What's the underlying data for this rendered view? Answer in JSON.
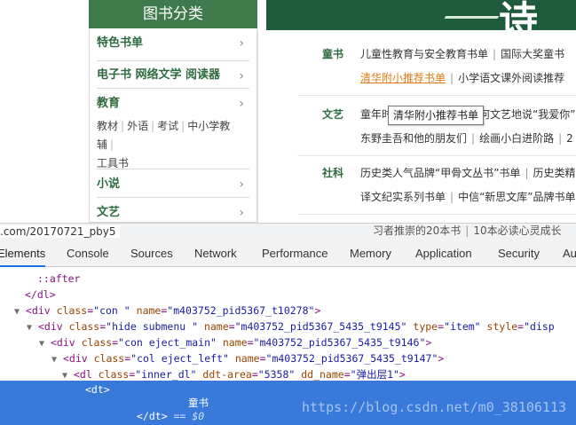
{
  "page": {
    "category_header": "图书分类",
    "banner_char": "诗",
    "side_menu": [
      {
        "title": "特色书单",
        "subs": []
      },
      {
        "title": "电子书 网络文学 阅读器",
        "subs": []
      },
      {
        "title": "教育",
        "subs": [
          "教材",
          "外语",
          "考试",
          "中小学教辅",
          "工具书"
        ]
      },
      {
        "title": "小说",
        "subs": []
      },
      {
        "title": "文艺",
        "subs": []
      }
    ],
    "arrow": "›",
    "sub_panel": {
      "rows": [
        {
          "label": "童书",
          "line1": [
            "儿童性教育与安全教育书单",
            "国际大奖童书"
          ],
          "line2": [
            "清华附小推荐书单",
            "小学语文课外阅读推荐"
          ]
        },
        {
          "label": "文艺",
          "line1": [
            "童年时",
            "何文艺地说“我爱你”"
          ],
          "line2": [
            "东野圭吾和他的朋友们",
            "绘画小白进阶路",
            "2"
          ]
        },
        {
          "label": "社科",
          "line1": [
            "历史类人气品牌“甲骨文丛书”书单",
            "历史类精"
          ],
          "line2": [
            "译文纪实系列书单",
            "中信“新思文库”品牌书单"
          ]
        }
      ],
      "last_line_fragment": "习者推崇的20本书",
      "last_line_fragment2": "10本必读心灵成长"
    },
    "tooltip": "清华附小推荐书单",
    "status_url": ".com/20170721_pby5"
  },
  "devtools": {
    "tabs": [
      "Elements",
      "Console",
      "Sources",
      "Network",
      "Performance",
      "Memory",
      "Application",
      "Security",
      "Au"
    ],
    "active_tab": "Elements",
    "lines": [
      {
        "indent": "    ",
        "content": "::after"
      },
      {
        "indent": "  ",
        "content": "</dl>"
      },
      {
        "indent": "",
        "content": "<div class=\"con \" name=\"m403752_pid5367_t10278\">"
      },
      {
        "indent": "  ",
        "content": "<div class=\"hide submenu \" name=\"m403752_pid5367_5435_t9145\" type=\"item\" style=\"disp"
      },
      {
        "indent": "    ",
        "content": "<div class=\"con eject_main\" name=\"m403752_pid5367_5435_t9146\">"
      },
      {
        "indent": "      ",
        "content": "<div class=\"col eject_left\" name=\"m403752_pid5367_5435_t9147\">"
      },
      {
        "indent": "        ",
        "content": "<dl class=\"inner_dl\" ddt-area=\"5358\" dd_name=\"弹出层1\">"
      }
    ],
    "selected": {
      "open_tag": "<dt>",
      "text": "童书",
      "close_tag": "</dt>",
      "eq": "== $0"
    },
    "watermark": "https://blog.csdn.net/m0_38106113"
  }
}
